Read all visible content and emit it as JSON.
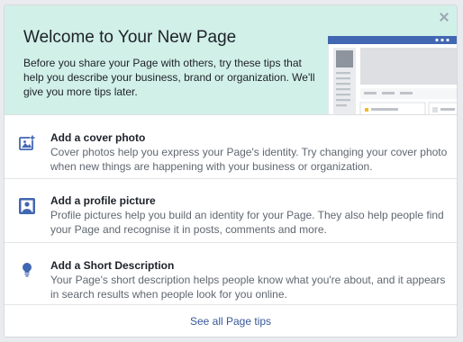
{
  "header": {
    "title": "Welcome to Your New Page",
    "body": "Before you share your Page with others, try these tips that help you describe your business, brand or organization. We'll give you more tips later.",
    "close_icon": "close-icon"
  },
  "tips": [
    {
      "icon": "photo-icon",
      "title": "Add a cover photo",
      "description": "Cover photos help you express your Page's identity. Try changing your cover photo when new things are happening with your business or organization."
    },
    {
      "icon": "profile-picture-icon",
      "title": "Add a profile picture",
      "description": "Profile pictures help you build an identity for your Page. They also help people find your Page and recognise it in posts, comments and more."
    },
    {
      "icon": "lightbulb-icon",
      "title": "Add a Short Description",
      "description": "Your Page's short description helps people know what you're about, and it appears in search results when people look for you online."
    }
  ],
  "footer": {
    "link_label": "See all Page tips"
  },
  "colors": {
    "header_bg": "#d1f0e7",
    "accent": "#4267b2",
    "link": "#385898",
    "title_text": "#1d2129",
    "body_text": "#606770"
  }
}
